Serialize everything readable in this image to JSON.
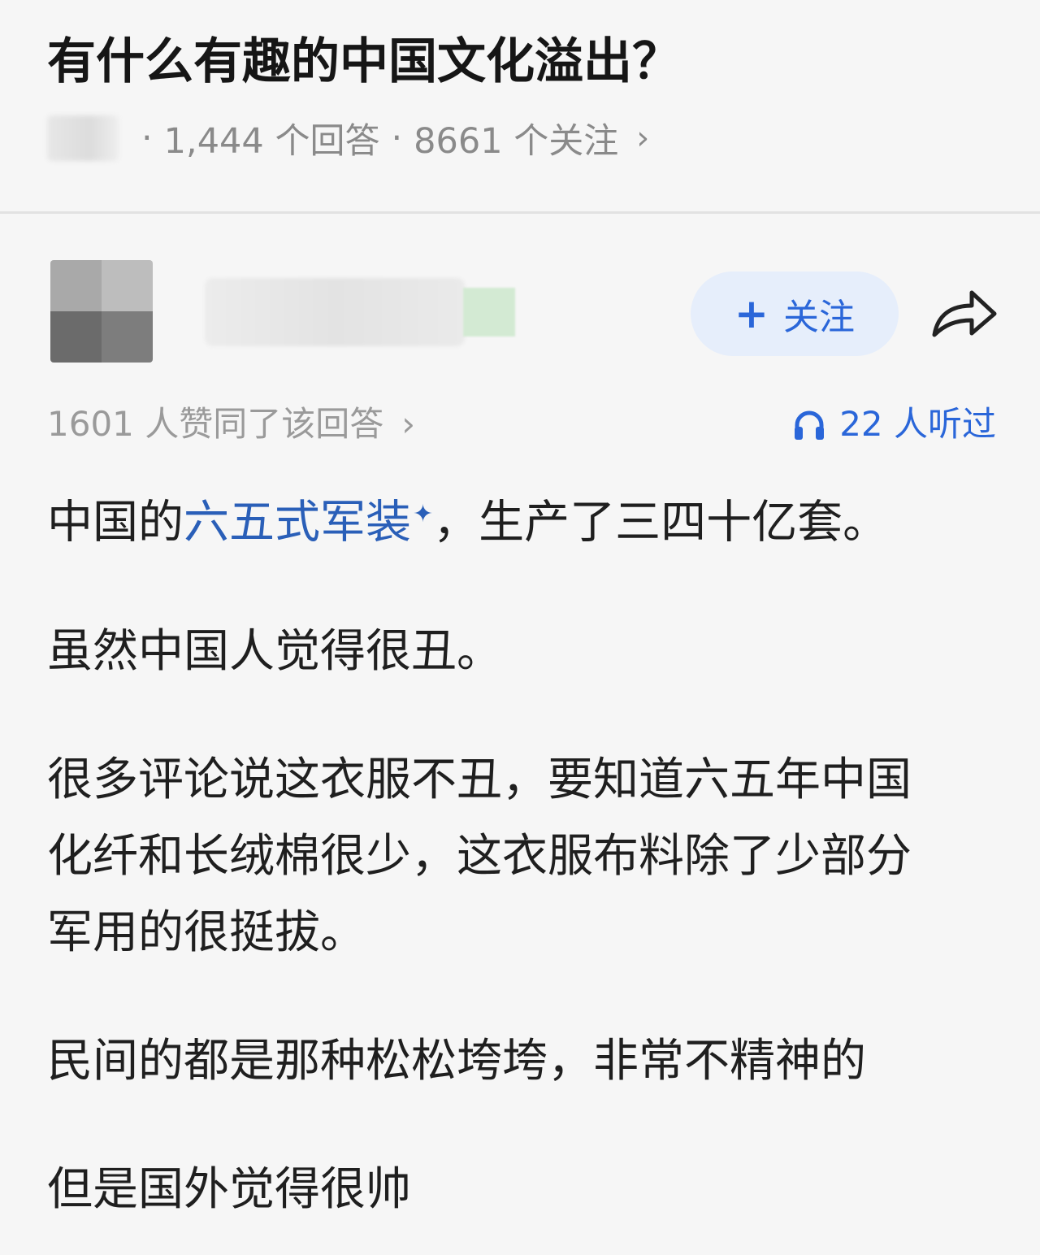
{
  "question": {
    "title": "有什么有趣的中国文化溢出？",
    "answer_count": "1,444 个回答",
    "follower_count": "8661 个关注",
    "separator": "·",
    "chevron": "›"
  },
  "author": {
    "follow_plus": "+",
    "follow_label": "关注"
  },
  "stats": {
    "upvotes": "1601 人赞同了该回答",
    "chevron": "›",
    "listened": "22 人听过"
  },
  "answer": {
    "p1_prefix": "中国的",
    "p1_link": "六五式军装",
    "p1_sparkle": "✦",
    "p1_suffix": "，生产了三四十亿套。",
    "p2": "虽然中国人觉得很丑。",
    "p3_line1": "很多评论说这衣服不丑，要知道六五年中国",
    "p3_line2": "化纤和长绒棉很少，这衣服布料除了少部分",
    "p3_line3": "军用的很挺拔。",
    "p4": "民间的都是那种松松垮垮，非常不精神的",
    "p5": "但是国外觉得很帅"
  },
  "colors": {
    "accent_blue": "#2a66d9",
    "follow_bg": "#e6eefb",
    "background": "#f6f6f6"
  },
  "icons": {
    "share": "share-arrow-icon",
    "listen": "headphone-icon"
  }
}
